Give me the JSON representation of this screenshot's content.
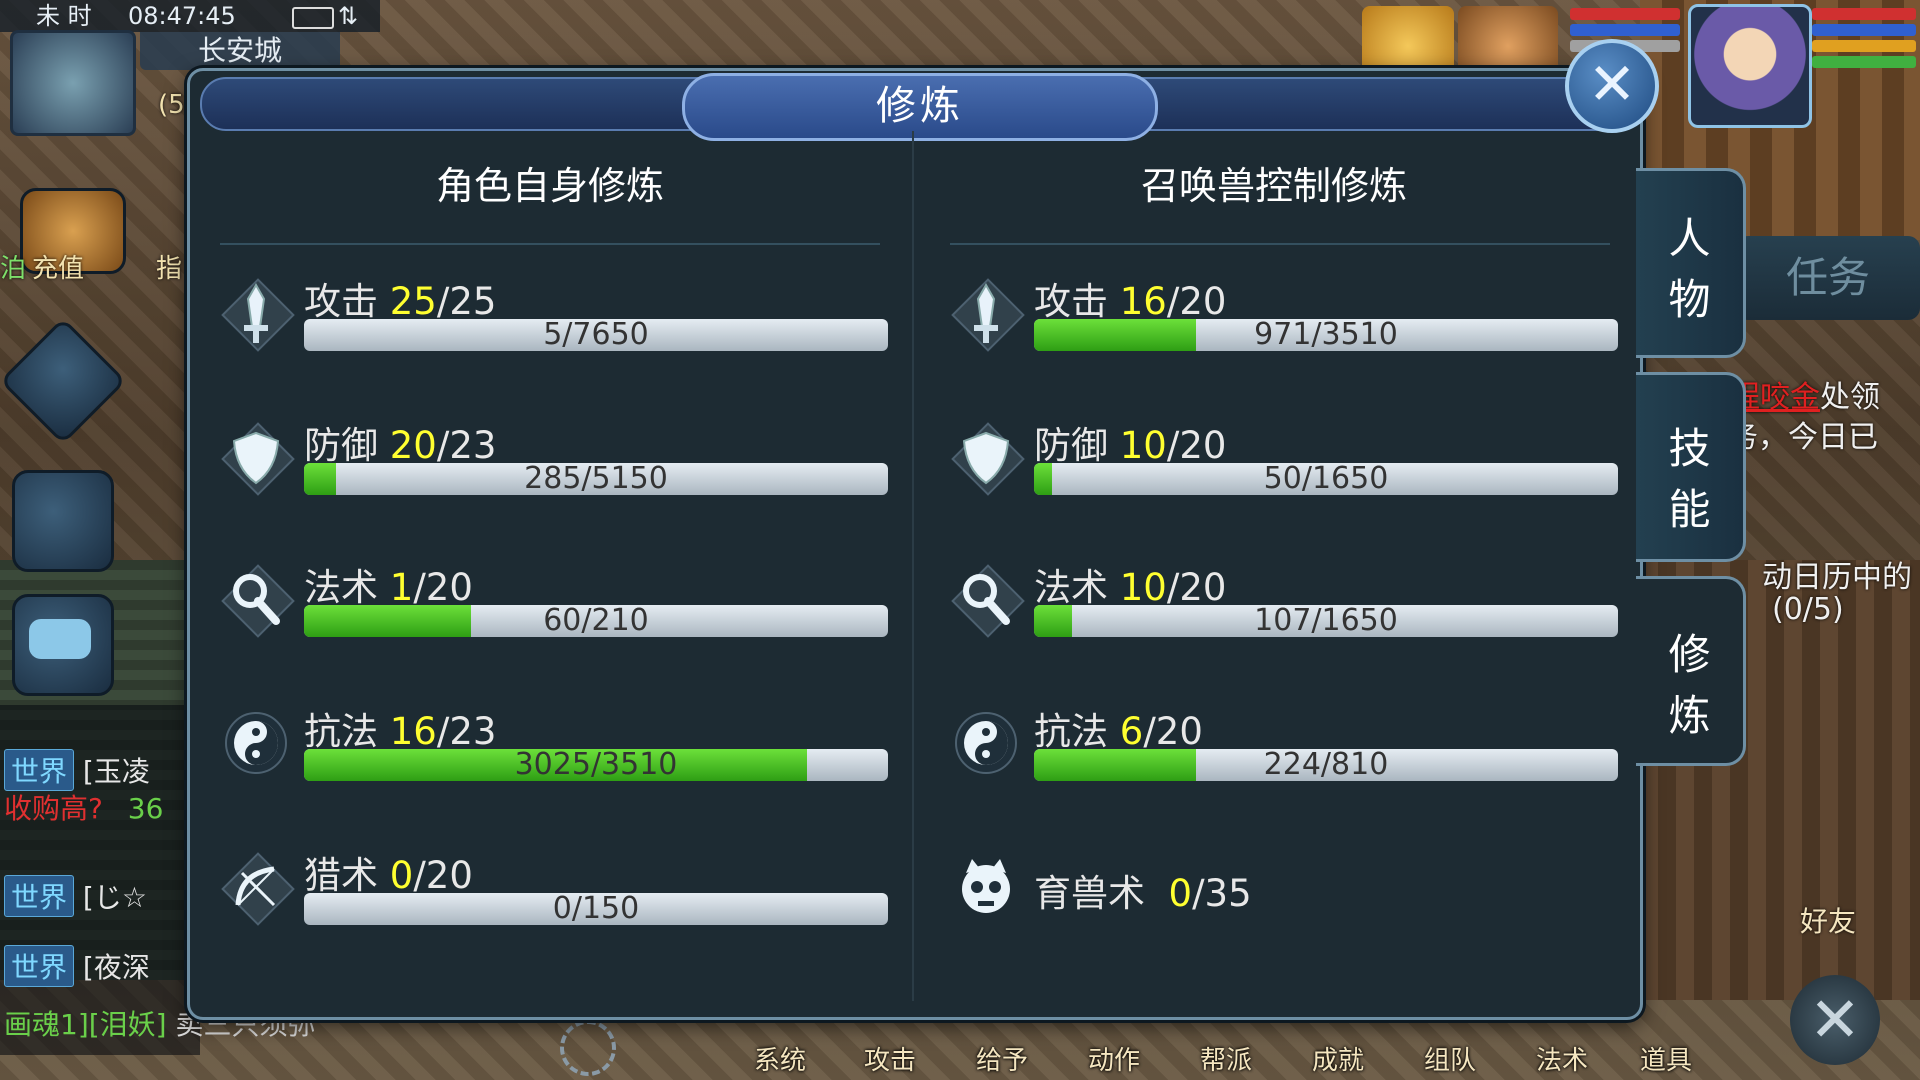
{
  "hud": {
    "period": "未 时",
    "clock": "08:47:45",
    "city": "长安城",
    "coord_partial": "(5",
    "recharge": "充值",
    "guide_partial": "指",
    "left_partial": "泊"
  },
  "chat": [
    {
      "channel": "世界",
      "name": "[玉凌",
      "msg": "收购高?",
      "num": "36"
    },
    {
      "channel": "世界",
      "name": "[じ☆"
    },
    {
      "channel": "世界",
      "name": "[夜深"
    },
    {
      "channel": "",
      "name": "画魂1][泪妖]",
      "msg": "卖三只须弥"
    }
  ],
  "bottom_bar": [
    "系统",
    "攻击",
    "给予",
    "动作",
    "帮派",
    "成就",
    "组队",
    "法术",
    "道具"
  ],
  "right_side": {
    "task_tab": "任务",
    "quest_name": "程咬金",
    "quest_line1_rest": "处领",
    "quest_line2": "务，今日已",
    "quest_line3": "动日历中的",
    "quest_line4": "(0/5)",
    "friend": "好友"
  },
  "panel": {
    "title": "修炼",
    "close": "✕",
    "left_title": "角色自身修炼",
    "right_title": "召唤兽控制修炼",
    "left_rows": [
      {
        "icon": "sword-icon",
        "label": "攻击",
        "cur": "25",
        "max": "/25",
        "progress": "5/7650",
        "fraction": 0.0007
      },
      {
        "icon": "shield-icon",
        "label": "防御",
        "cur": "20",
        "max": "/23",
        "progress": "285/5150",
        "fraction": 0.055
      },
      {
        "icon": "magic-staff-icon",
        "label": "法术",
        "cur": "1",
        "max": "/20",
        "progress": "60/210",
        "fraction": 0.286
      },
      {
        "icon": "yin-yang-icon",
        "label": "抗法",
        "cur": "16",
        "max": "/23",
        "progress": "3025/3510",
        "fraction": 0.862
      },
      {
        "icon": "bow-icon",
        "label": "猎术",
        "cur": "0",
        "max": "/20",
        "progress": "0/150",
        "fraction": 0
      }
    ],
    "right_rows": [
      {
        "icon": "sword-icon",
        "label": "攻击",
        "cur": "16",
        "max": "/20",
        "progress": "971/3510",
        "fraction": 0.277
      },
      {
        "icon": "shield-icon",
        "label": "防御",
        "cur": "10",
        "max": "/20",
        "progress": "50/1650",
        "fraction": 0.03
      },
      {
        "icon": "magic-staff-icon",
        "label": "法术",
        "cur": "10",
        "max": "/20",
        "progress": "107/1650",
        "fraction": 0.065
      },
      {
        "icon": "yin-yang-icon",
        "label": "抗法",
        "cur": "6",
        "max": "/20",
        "progress": "224/810",
        "fraction": 0.277
      }
    ],
    "beast_row": {
      "icon": "beast-skull-icon",
      "label": "育兽术",
      "cur": "0",
      "max": "/35"
    }
  },
  "side_tabs": [
    {
      "label": "人物",
      "line1": "人",
      "line2": "物"
    },
    {
      "label": "技能",
      "line1": "技",
      "line2": "能"
    },
    {
      "label": "修炼",
      "line1": "修",
      "line2": "炼"
    }
  ]
}
